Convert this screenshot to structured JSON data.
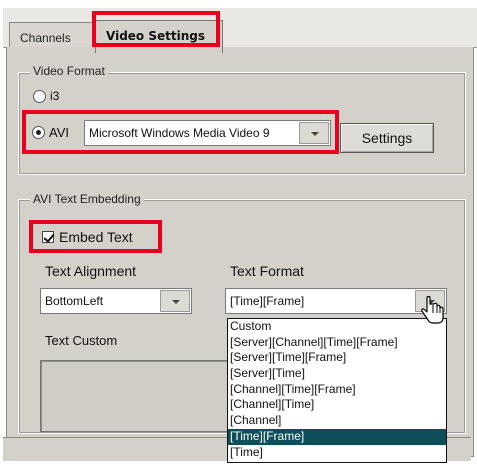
{
  "tabs": [
    {
      "label": "Channels"
    },
    {
      "label": "Video Settings"
    }
  ],
  "video_format": {
    "legend": "Video Format",
    "option_i3": "i3",
    "option_avi": "AVI",
    "codec_value": "Microsoft Windows Media Video 9",
    "settings_button": "Settings"
  },
  "avi_text": {
    "legend": "AVI Text Embedding",
    "embed_text_label": "Embed Text",
    "text_alignment_label": "Text Alignment",
    "text_alignment_value": "BottomLeft",
    "text_format_label": "Text Format",
    "text_format_value": "[Time][Frame]",
    "text_custom_label": "Text Custom",
    "format_options": [
      "Custom",
      "[Server][Channel][Time][Frame]",
      "[Server][Time][Frame]",
      "[Server][Time]",
      "[Channel][Time][Frame]",
      "[Channel][Time]",
      "[Channel]",
      "[Time][Frame]",
      "[Time]"
    ],
    "selected_format_index": 7
  },
  "colors": {
    "highlight_box": "#e8001c",
    "selection": "#0e4e5a"
  }
}
